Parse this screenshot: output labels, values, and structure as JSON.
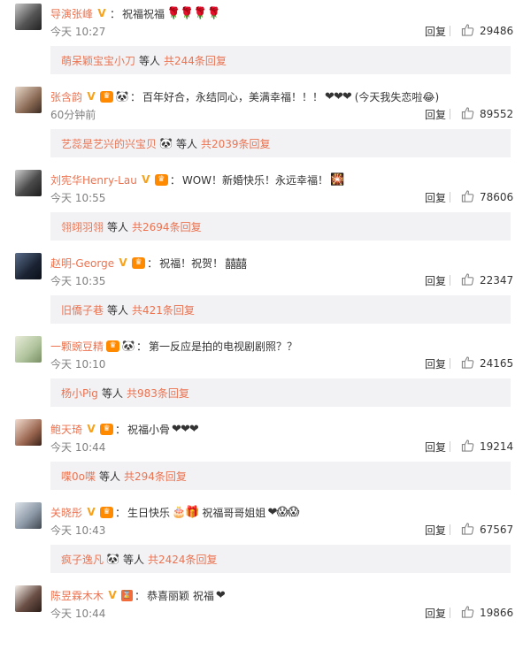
{
  "comments": [
    {
      "username": "导演张峰",
      "badges": [
        "v"
      ],
      "text": "祝福祝福",
      "emojis": "🌹🌹🌹🌹",
      "time": "今天 10:27",
      "reply_label": "回复",
      "likes": "29486",
      "sub": {
        "user": "萌呆颖宝宝小刀",
        "badge": "",
        "etc": "等人",
        "total": "共244条回复"
      }
    },
    {
      "username": "张含韵",
      "badges": [
        "v",
        "vip",
        "panda"
      ],
      "text": "百年好合，永结同心，美满幸福！！！",
      "emojis": "❤❤❤",
      "text2": "(今天我失恋啦😂)",
      "time": "60分钟前",
      "reply_label": "回复",
      "likes": "89552",
      "sub": {
        "user": "艺蕊是艺兴的兴宝贝",
        "badge": "🐼",
        "etc": "等人",
        "total": "共2039条回复"
      }
    },
    {
      "username": "刘宪华Henry-Lau",
      "badges": [
        "v",
        "vip"
      ],
      "text": "WOW！新婚快乐！永远幸福！",
      "emojis": "🎇",
      "time": "今天 10:55",
      "reply_label": "回复",
      "likes": "78606",
      "sub": {
        "user": "翎翊羽翎",
        "badge": "",
        "etc": "等人",
        "total": "共2694条回复"
      }
    },
    {
      "username": "赵明-George",
      "badges": [
        "v",
        "vip"
      ],
      "text": "祝福！祝贺！",
      "emojis": "囍囍",
      "time": "今天 10:35",
      "reply_label": "回复",
      "likes": "22347",
      "sub": {
        "user": "旧僑子巷",
        "badge": "",
        "etc": "等人",
        "total": "共421条回复"
      }
    },
    {
      "username": "一颗豌豆精",
      "badges": [
        "vip",
        "panda"
      ],
      "text": "第一反应是拍的电视剧剧照？？",
      "emojis": "",
      "time": "今天 10:10",
      "reply_label": "回复",
      "likes": "24165",
      "sub": {
        "user": "杨小Pig",
        "badge": "",
        "etc": "等人",
        "total": "共983条回复"
      }
    },
    {
      "username": "鲍天琦",
      "badges": [
        "v",
        "vip"
      ],
      "text": "祝福小骨",
      "emojis": "❤❤❤",
      "time": "今天 10:44",
      "reply_label": "回复",
      "likes": "19214",
      "sub": {
        "user": "喋0o喋",
        "badge": "",
        "etc": "等人",
        "total": "共294条回复"
      }
    },
    {
      "username": "关晓彤",
      "badges": [
        "v",
        "vip"
      ],
      "text": "生日快乐",
      "emojis": "🎂🎁",
      "text2": "祝福哥哥姐姐",
      "emojis2": "❤😱😱",
      "time": "今天 10:43",
      "reply_label": "回复",
      "likes": "67567",
      "sub": {
        "user": "疯子逸凡",
        "badge": "🐼",
        "etc": "等人",
        "total": "共2424条回复"
      }
    },
    {
      "username": "陈昱霖木木",
      "badges": [
        "v",
        "hourglass"
      ],
      "text": "恭喜丽颖 祝福",
      "emojis": "❤",
      "time": "今天 10:44",
      "reply_label": "回复",
      "likes": "19866"
    }
  ],
  "colors": {
    "username": "#eb7350",
    "subbox": "#f2f2f5",
    "time": "#808080"
  },
  "icons": {
    "like": "thumbs-up-icon",
    "verified": "v-verified-icon",
    "vip": "vip-crown-icon",
    "panda": "panda-icon"
  }
}
